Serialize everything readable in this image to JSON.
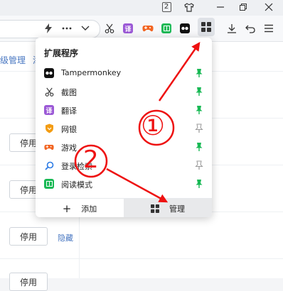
{
  "titlebar": {
    "tab_count": "2"
  },
  "page": {
    "link_left": "级管理",
    "link_right": "添",
    "button_stop": "停用",
    "link_hide": "隐藏"
  },
  "popup": {
    "title": "扩展程序",
    "extensions": [
      {
        "name": "Tampermonkey",
        "icon": "tampermonkey-icon",
        "color": "#111111",
        "pinned": true
      },
      {
        "name": "截图",
        "icon": "scissors-icon",
        "color": "#333333",
        "pinned": true
      },
      {
        "name": "翻译",
        "icon": "translate-icon",
        "color": "#9b59d6",
        "pinned": true
      },
      {
        "name": "网银",
        "icon": "bank-shield-icon",
        "color": "#f39c12",
        "pinned": false
      },
      {
        "name": "游戏",
        "icon": "gamepad-icon",
        "color": "#f26522",
        "pinned": true
      },
      {
        "name": "登录检索",
        "icon": "search-icon",
        "color": "#2c7be5",
        "pinned": false
      },
      {
        "name": "阅读模式",
        "icon": "book-icon",
        "color": "#19b955",
        "pinned": true
      }
    ],
    "footer": {
      "add_label": "添加",
      "manage_label": "管理"
    }
  },
  "annotations": {
    "step1": "①",
    "step2": "2",
    "color": "#e11111"
  },
  "colors": {
    "pin_on": "#19b955",
    "pin_off": "#999999",
    "link": "#4a78c2"
  }
}
